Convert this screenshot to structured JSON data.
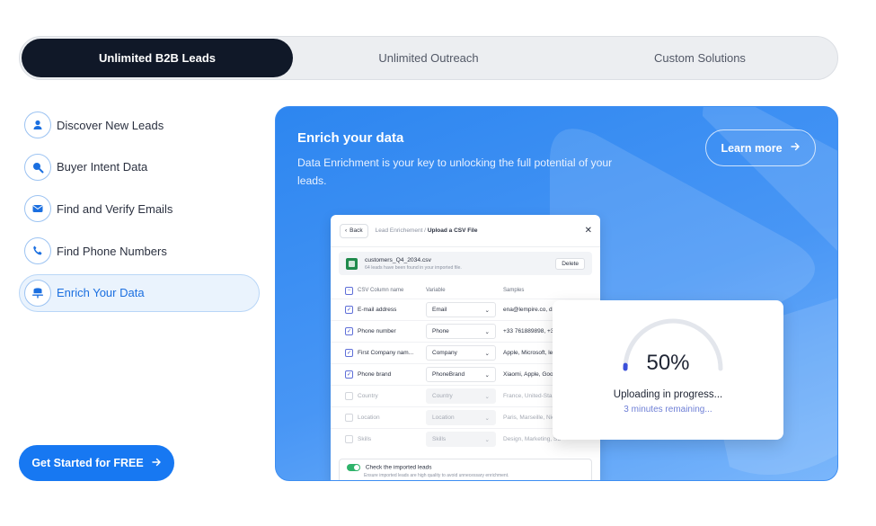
{
  "tabs": [
    {
      "label": "Unlimited B2B Leads",
      "active": true
    },
    {
      "label": "Unlimited Outreach",
      "active": false
    },
    {
      "label": "Custom Solutions",
      "active": false
    }
  ],
  "menu": [
    {
      "label": "Discover New Leads",
      "icon": "user-icon"
    },
    {
      "label": "Buyer Intent Data",
      "icon": "search-icon"
    },
    {
      "label": "Find and Verify Emails",
      "icon": "mail-icon"
    },
    {
      "label": "Find Phone Numbers",
      "icon": "phone-icon"
    },
    {
      "label": "Enrich Your Data",
      "icon": "database-icon",
      "active": true
    }
  ],
  "cta_label": "Get Started for FREE",
  "panel": {
    "title": "Enrich your data",
    "description": "Data Enrichment is your key to unlocking the full potential of your leads.",
    "learn_more": "Learn more"
  },
  "modal": {
    "back": "Back",
    "breadcrumb_parent": "Lead Enrichement /",
    "breadcrumb_current": "Upload a CSV File",
    "close": "✕",
    "file_name": "customers_Q4_2034.csv",
    "file_sub": "64 leads have been found in your imported file.",
    "delete": "Delete",
    "columns": {
      "name": "CSV Column name",
      "variable": "Variable",
      "samples": "Samples"
    },
    "rows": [
      {
        "name": "E-mail address",
        "variable": "Email",
        "sample": "ena@lempire.co, d",
        "checked": true
      },
      {
        "name": "Phone number",
        "variable": "Phone",
        "sample": "+33 761889898, +3",
        "checked": true
      },
      {
        "name": "First Company nam...",
        "variable": "Company",
        "sample": "Apple, Microsoft, le",
        "checked": true
      },
      {
        "name": "Phone brand",
        "variable": "PhoneBrand",
        "sample": "Xiaomi, Apple, Goo",
        "checked": true
      },
      {
        "name": "Country",
        "variable": "Country",
        "sample": "France, United-Sta",
        "checked": false
      },
      {
        "name": "Location",
        "variable": "Location",
        "sample": "Paris, Marseille, Nic",
        "checked": false
      },
      {
        "name": "Skills",
        "variable": "Skills",
        "sample": "Design, Marketing, SEO, Busi...",
        "checked": false
      }
    ],
    "check_imported": "Check the imported leads",
    "check_imported_sub": "Ensure imported leads are high quality to avoid unnecessary enrichment."
  },
  "progress": {
    "percent": 50,
    "percent_label": "50%",
    "status": "Uploading in progress...",
    "remaining": "3 minutes remaining..."
  },
  "colors": {
    "accent": "#1778f2",
    "dark": "#101828",
    "panel": "#3a8ef3"
  }
}
